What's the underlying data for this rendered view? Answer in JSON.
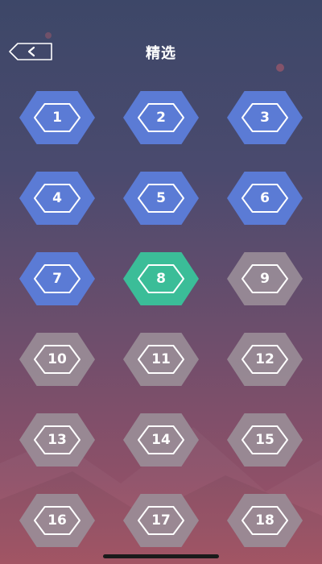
{
  "header": {
    "title": "精选",
    "back_icon": "chevron-left-icon"
  },
  "colors": {
    "unlocked": "#5b7bd5",
    "current": "#3bbd98",
    "locked": "#9a8e98",
    "background_top": "#3d4768",
    "background_bottom": "#a85464"
  },
  "levels": [
    {
      "number": "1",
      "state": "unlocked"
    },
    {
      "number": "2",
      "state": "unlocked"
    },
    {
      "number": "3",
      "state": "unlocked"
    },
    {
      "number": "4",
      "state": "unlocked"
    },
    {
      "number": "5",
      "state": "unlocked"
    },
    {
      "number": "6",
      "state": "unlocked"
    },
    {
      "number": "7",
      "state": "unlocked"
    },
    {
      "number": "8",
      "state": "current"
    },
    {
      "number": "9",
      "state": "locked"
    },
    {
      "number": "10",
      "state": "locked"
    },
    {
      "number": "11",
      "state": "locked"
    },
    {
      "number": "12",
      "state": "locked"
    },
    {
      "number": "13",
      "state": "locked"
    },
    {
      "number": "14",
      "state": "locked"
    },
    {
      "number": "15",
      "state": "locked"
    },
    {
      "number": "16",
      "state": "locked"
    },
    {
      "number": "17",
      "state": "locked"
    },
    {
      "number": "18",
      "state": "locked"
    }
  ]
}
